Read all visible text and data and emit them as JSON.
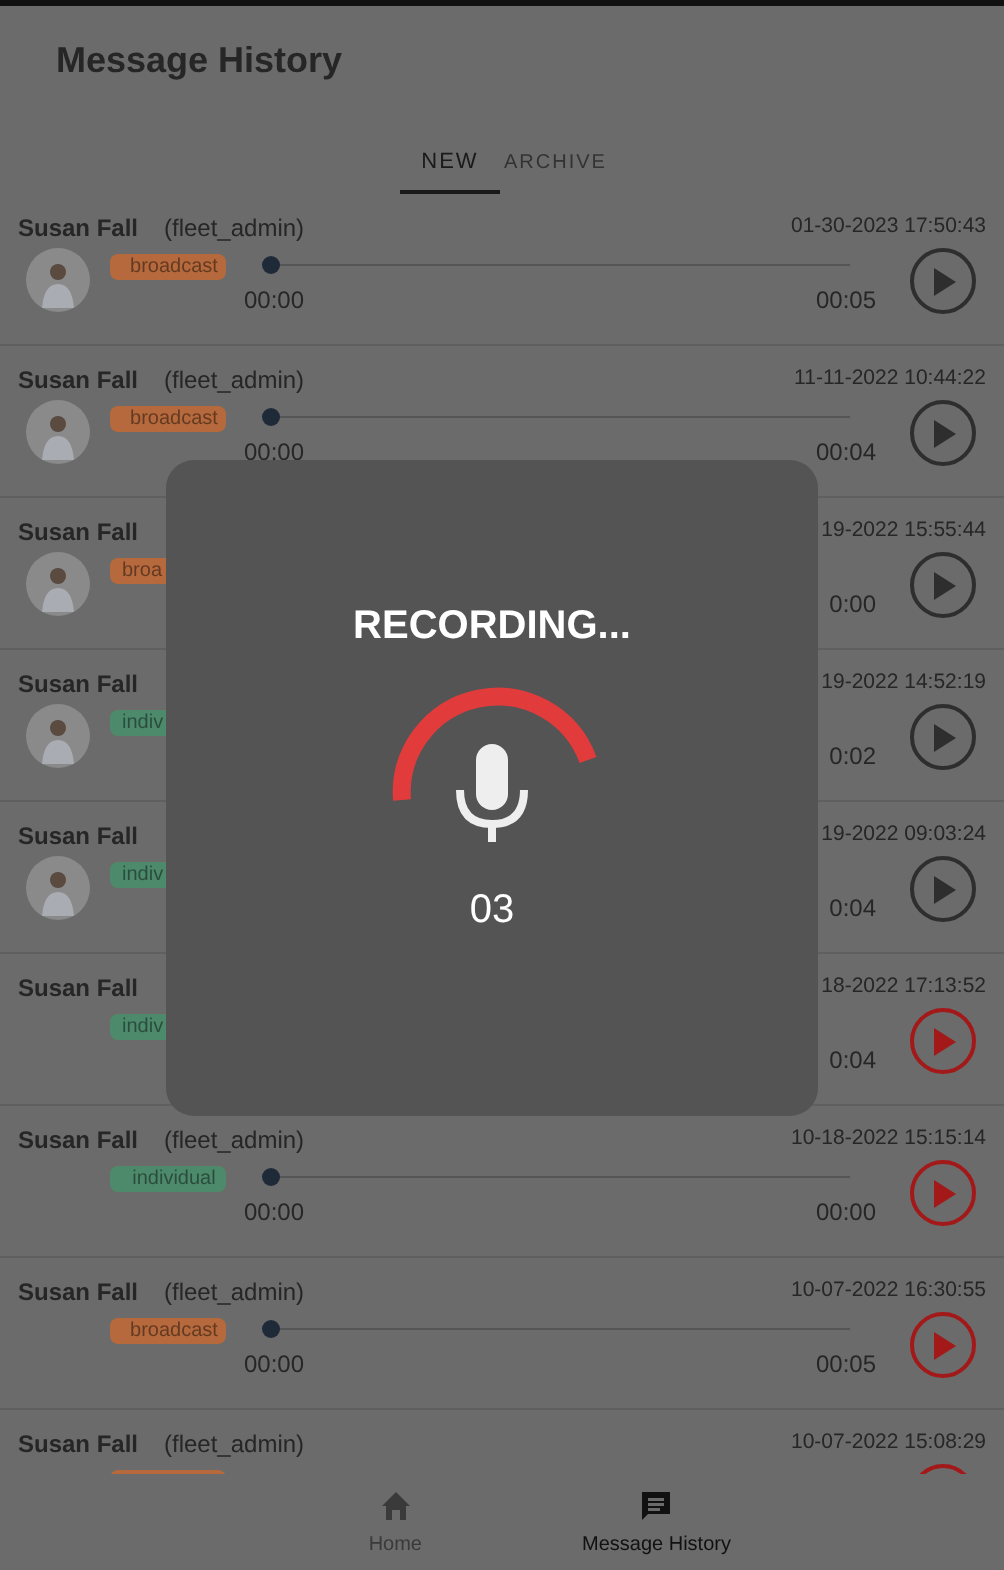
{
  "header": {
    "title": "Message History"
  },
  "tabs": [
    {
      "label": "NEW",
      "selected": true
    },
    {
      "label": "ARCHIVE",
      "selected": false
    }
  ],
  "messages": [
    {
      "name": "Susan Fall",
      "role": "(fleet_admin)",
      "timestamp": "01-30-2023 17:50:43",
      "avatar": true,
      "tag": {
        "label": "broadcast",
        "color": "#b5693c"
      },
      "level": 0,
      "current": "00:00",
      "duration": "00:05",
      "played": true
    },
    {
      "name": "Susan Fall",
      "role": "(fleet_admin)",
      "timestamp": "11-11-2022 10:44:22",
      "avatar": true,
      "tag": {
        "label": "broadcast",
        "color": "#b5693c"
      },
      "level": 0,
      "current": "00:00",
      "duration": "00:04",
      "played": true
    },
    {
      "name": "Susan Fall",
      "timestamp": "19-2022 15:55:44",
      "avatar": true,
      "tag": {
        "label": "broa",
        "color": "#b5693c"
      },
      "duration": "0:00",
      "played": true
    },
    {
      "name": "Susan Fall",
      "timestamp": "19-2022 14:52:19",
      "avatar": true,
      "tag": {
        "label": "indiv",
        "color": "#4d8a6c"
      },
      "duration": "0:02",
      "played": true
    },
    {
      "name": "Susan Fall",
      "timestamp": "19-2022 09:03:24",
      "avatar": true,
      "tag": {
        "label": "indiv",
        "color": "#4d8a6c"
      },
      "duration": "0:04",
      "played": true
    },
    {
      "name": "Susan Fall",
      "timestamp": "18-2022 17:13:52",
      "avatar": false,
      "tag": {
        "label": "indiv",
        "color": "#4d8a6c"
      },
      "duration": "0:04",
      "played": false
    },
    {
      "name": "Susan Fall",
      "role": "(fleet_admin)",
      "timestamp": "10-18-2022 15:15:14",
      "avatar": false,
      "tag": {
        "label": "individual",
        "color": "#4d8a6c"
      },
      "level": 0,
      "current": "00:00",
      "duration": "00:00",
      "played": false
    },
    {
      "name": "Susan Fall",
      "role": "(fleet_admin)",
      "timestamp": "10-07-2022 16:30:55",
      "avatar": false,
      "tag": {
        "label": "broadcast",
        "color": "#b5693c"
      },
      "level": 0,
      "current": "00:00",
      "duration": "00:05",
      "played": false
    },
    {
      "name": "Susan Fall",
      "role": "(fleet_admin)",
      "timestamp": "10-07-2022 15:08:29",
      "avatar": false,
      "tag": {
        "color": "#b5693c"
      },
      "played": false
    }
  ],
  "recording_dialog": {
    "title": "RECORDING...",
    "counter": "03"
  },
  "bottom_nav": [
    {
      "label": "Home",
      "selected": false
    },
    {
      "label": "Message History",
      "selected": true
    }
  ]
}
